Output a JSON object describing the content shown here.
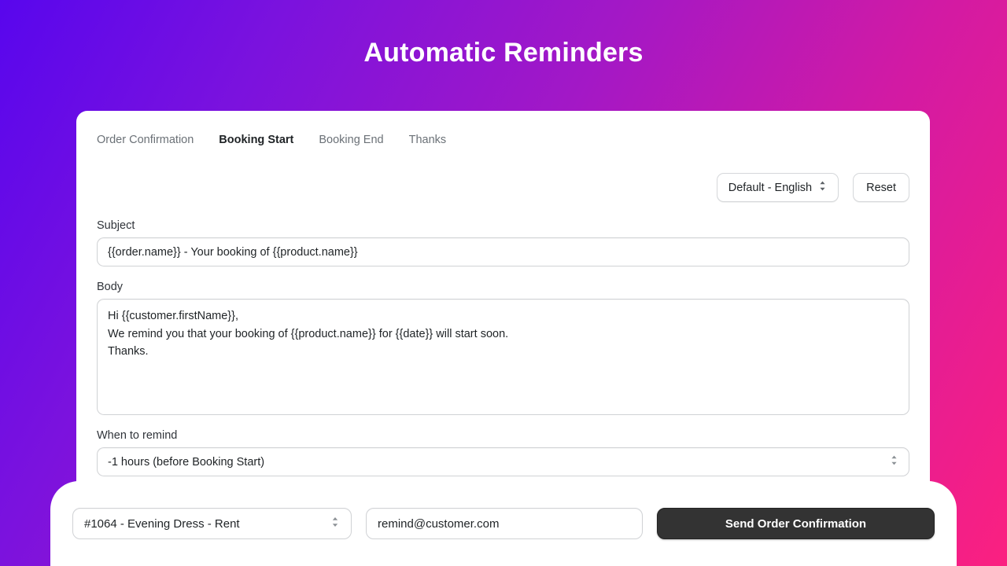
{
  "page": {
    "title": "Automatic Reminders"
  },
  "theme": {
    "gradient_start": "#5806ED",
    "gradient_mid": "#A318C6",
    "gradient_end": "#FB2080",
    "card_bg": "#FFFFFF",
    "send_button_bg": "#333333",
    "active_tab_color": "#1F2326",
    "inactive_tab_color": "#6B7177"
  },
  "tabs": [
    {
      "label": "Order Confirmation",
      "active": false
    },
    {
      "label": "Booking Start",
      "active": true
    },
    {
      "label": "Booking End",
      "active": false
    },
    {
      "label": "Thanks",
      "active": false
    }
  ],
  "toolbar": {
    "language_value": "Default - English",
    "language_icon": "chevron-up-down-icon",
    "reset_label": "Reset"
  },
  "form": {
    "subject": {
      "label": "Subject",
      "value": "{{order.name}} - Your booking of {{product.name}}"
    },
    "body": {
      "label": "Body",
      "value": "Hi {{customer.firstName}},\nWe remind you that your booking of {{product.name}} for {{date}} will start soon.\nThanks."
    },
    "when_to_remind": {
      "label": "When to remind",
      "value": "-1 hours (before Booking Start)",
      "icon": "chevron-up-down-icon"
    }
  },
  "bottom_bar": {
    "order_select_value": "#1064 - Evening Dress - Rent",
    "order_select_icon": "chevron-up-down-icon",
    "email_value": "remind@customer.com",
    "email_placeholder": "remind@customer.com",
    "send_label": "Send Order Confirmation"
  }
}
